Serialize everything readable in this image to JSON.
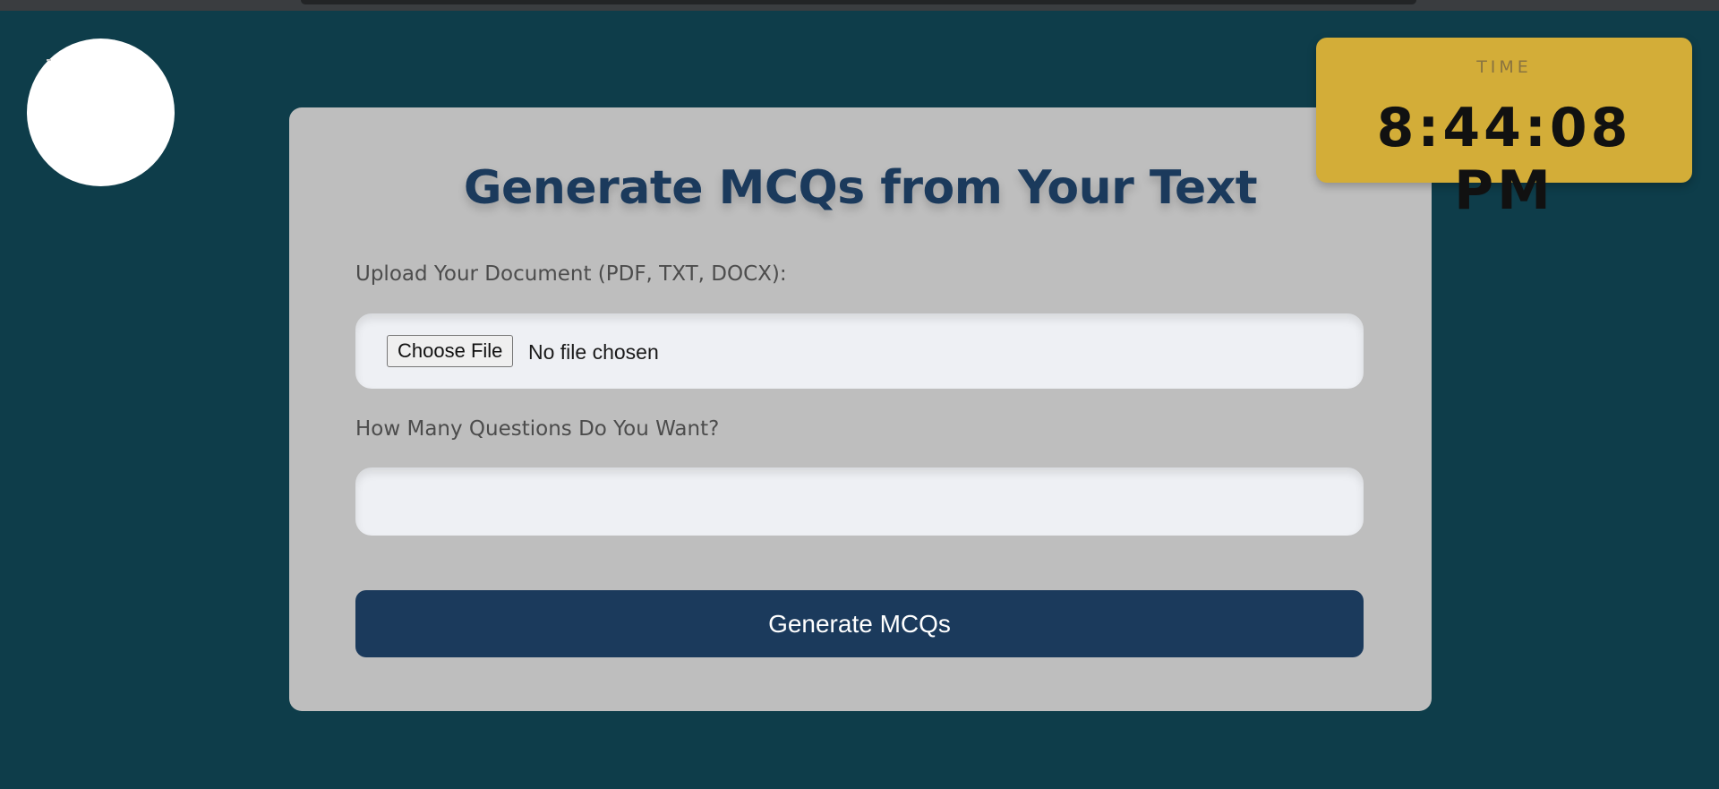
{
  "clock": {
    "label": "TIME",
    "time": "8:44:08 PM"
  },
  "form": {
    "title": "Generate MCQs from Your Text",
    "upload_label": "Upload Your Document (PDF, TXT, DOCX):",
    "choose_file_label": "Choose File",
    "file_status": "No file chosen",
    "count_label": "How Many Questions Do You Want?",
    "count_value": "",
    "submit_label": "Generate MCQs"
  },
  "colors": {
    "background": "#0e3d4a",
    "card": "#bebebe",
    "accent": "#1b3a5c",
    "clock": "#d3ad38"
  }
}
